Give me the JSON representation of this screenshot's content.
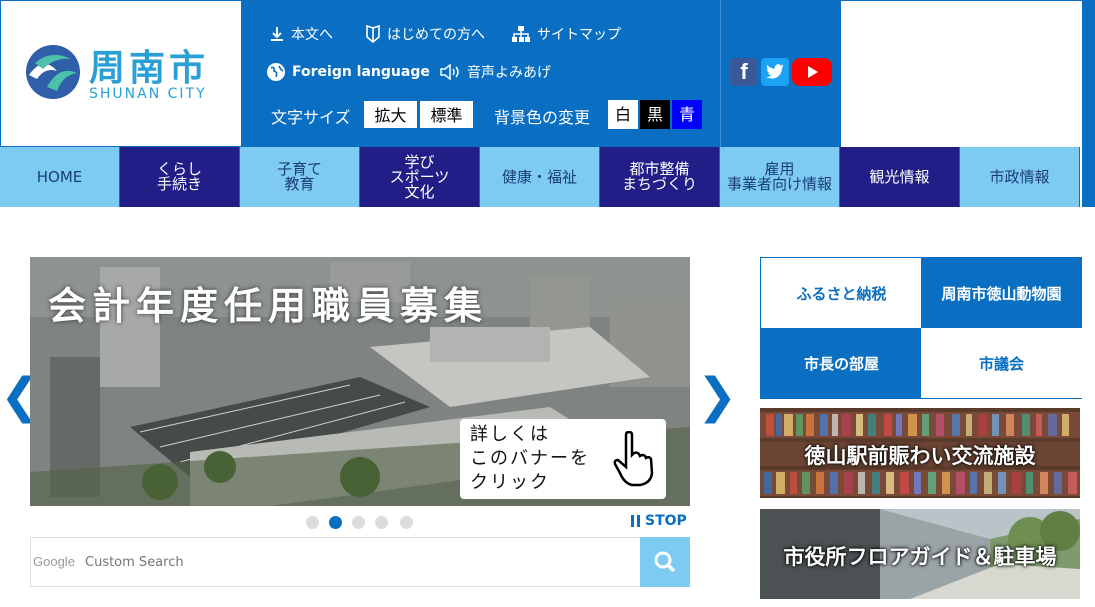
{
  "logo": {
    "title": "周南市",
    "subtitle": "SHUNAN CITY"
  },
  "util": {
    "skip_label": "本文へ",
    "beginners_label": "はじめての方へ",
    "sitemap_label": "サイトマップ",
    "foreign_label": "Foreign language",
    "voice_label": "音声よみあげ",
    "font_size_label": "文字サイズ",
    "font_large": "拡大",
    "font_normal": "標準",
    "bg_label": "背景色の変更",
    "bg_white": "白",
    "bg_black": "黒",
    "bg_blue": "青"
  },
  "sns": {
    "facebook": "f",
    "twitter": "twitter",
    "youtube": "youtube"
  },
  "nav": [
    {
      "label": "HOME"
    },
    {
      "label": "くらし\n手続き"
    },
    {
      "label": "子育て\n教育"
    },
    {
      "label": "学び\nスポーツ\n文化"
    },
    {
      "label": "健康・福祉"
    },
    {
      "label": "都市整備\nまちづくり"
    },
    {
      "label": "雇用\n事業者向け情報"
    },
    {
      "label": "観光情報"
    },
    {
      "label": "市政情報"
    }
  ],
  "slider": {
    "title": "会計年度任用職員募集",
    "callout_line1": "詳しくは",
    "callout_line2": "このバナーを",
    "callout_line3": "クリック",
    "prev": "❮",
    "next": "❯",
    "stop_label": "STOP",
    "active_dot": 2
  },
  "search": {
    "brand": "Google",
    "placeholder": "Custom Search"
  },
  "quick_links": [
    {
      "label": "ふるさと納税"
    },
    {
      "label": "周南市徳山動物園"
    },
    {
      "label": "市長の部屋"
    },
    {
      "label": "市議会"
    }
  ],
  "banners": [
    {
      "title": "徳山駅前賑わい交流施設"
    },
    {
      "title": "市役所フロアガイド＆駐車場"
    }
  ],
  "colors": {
    "primary": "#0a6fc2",
    "nav_light": "#7ecbf2",
    "nav_dark": "#221e88"
  }
}
